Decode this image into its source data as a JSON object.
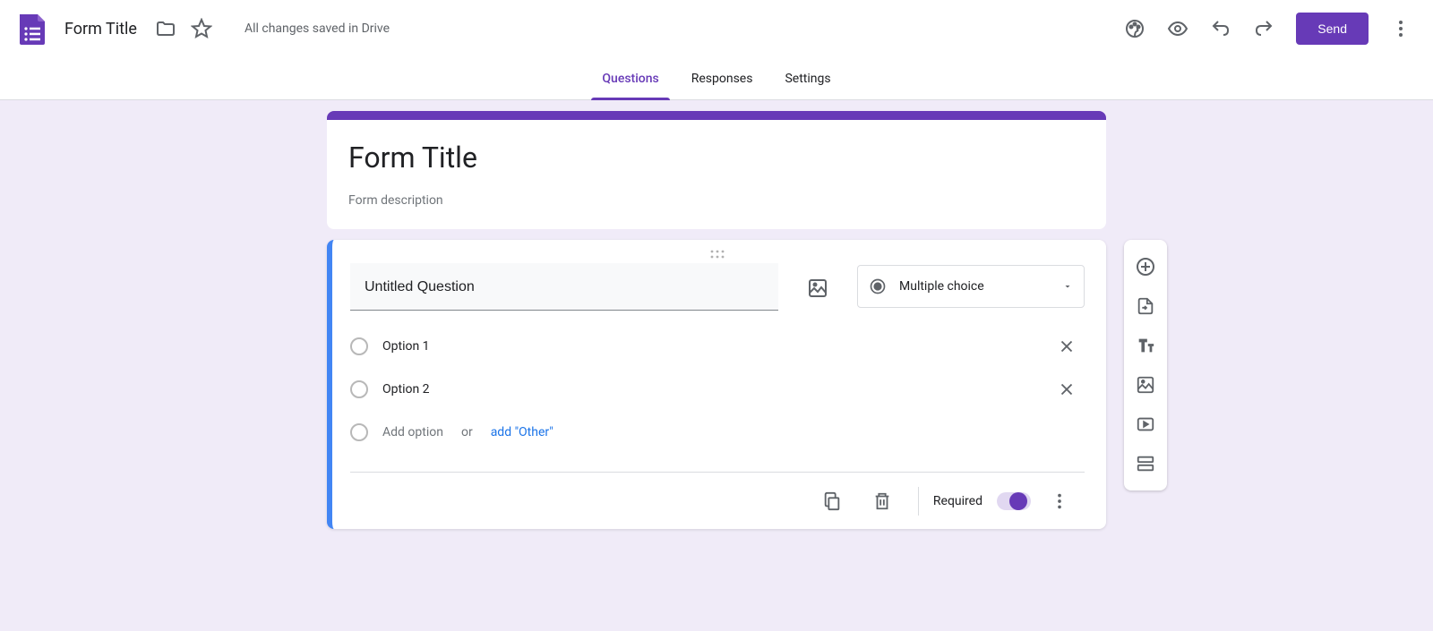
{
  "header": {
    "form_name": "Form Title",
    "save_status": "All changes saved in Drive",
    "send_label": "Send"
  },
  "tabs": {
    "questions": "Questions",
    "responses": "Responses",
    "settings": "Settings"
  },
  "title_card": {
    "title": "Form Title",
    "description": "Form description"
  },
  "question": {
    "title": "Untitled Question",
    "type_label": "Multiple choice",
    "options": [
      "Option 1",
      "Option 2"
    ],
    "add_option": "Add option",
    "or": "or",
    "add_other": "add \"Other\"",
    "required_label": "Required"
  },
  "colors": {
    "primary": "#673ab7",
    "canvas": "#f0ebf8"
  }
}
